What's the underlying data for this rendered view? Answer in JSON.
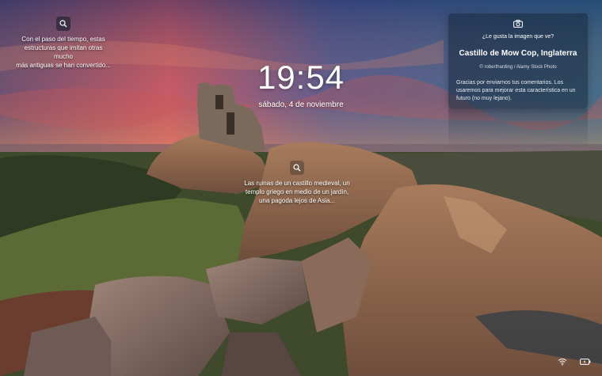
{
  "lockscreen": {
    "time": "19:54",
    "date": "sábado, 4 de noviembre"
  },
  "hotspots": [
    {
      "icon": "search-icon",
      "lines": [
        "Con el paso del tiempo, estas",
        "estructuras que imitan otras mucho",
        "más antiguas se han convertido..."
      ]
    },
    {
      "icon": "search-icon",
      "lines": [
        "Las ruinas de un castillo medieval, un",
        "templo griego en medio de un jardín,",
        "una pagoda lejos de Asia..."
      ]
    }
  ],
  "spotlight": {
    "icon": "camera-icon",
    "question": "¿Le gusta la imagen que ve?",
    "title": "Castillo de Mow Cop, Inglaterra",
    "credit": "© robertharding / Alamy Stock Photo",
    "thanks": [
      "Gracias por enviarnos tus comentarios. Los",
      "usaremos para mejorar esta característica en un",
      "futuro (no muy lejano)."
    ]
  },
  "tray": {
    "icons": [
      "wifi-icon",
      "battery-icon"
    ]
  }
}
